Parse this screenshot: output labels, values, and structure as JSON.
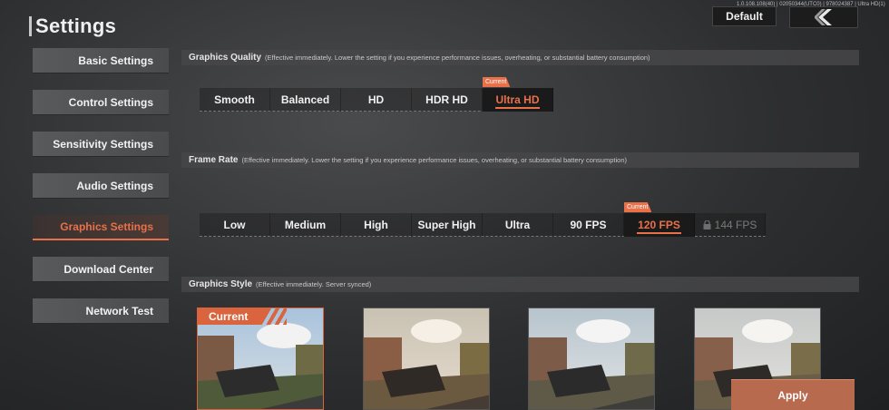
{
  "header": {
    "title": "Settings",
    "build_info": "1.0.108.108(40) | 02050344(UTC0) | 978024387 | Ultra HD(1)",
    "default_label": "Default",
    "back_icon": "chevron-left-icon"
  },
  "sidebar": {
    "items": [
      {
        "label": "Basic Settings",
        "active": false
      },
      {
        "label": "Control Settings",
        "active": false
      },
      {
        "label": "Sensitivity Settings",
        "active": false
      },
      {
        "label": "Audio Settings",
        "active": false
      },
      {
        "label": "Graphics Settings",
        "active": true
      },
      {
        "label": "Download Center",
        "active": false
      },
      {
        "label": "Network Test",
        "active": false
      }
    ]
  },
  "graphics_quality": {
    "title": "Graphics Quality",
    "note": "(Effective immediately. Lower the setting if you experience performance issues, overheating, or substantial battery consumption)",
    "options": [
      "Smooth",
      "Balanced",
      "HD",
      "HDR HD",
      "Ultra HD"
    ],
    "selected": "Ultra HD",
    "current_badge": "Current"
  },
  "frame_rate": {
    "title": "Frame Rate",
    "note": "(Effective immediately. Lower the setting if you experience performance issues, overheating, or substantial battery consumption)",
    "options": [
      "Low",
      "Medium",
      "High",
      "Super High",
      "Ultra",
      "90 FPS",
      "120 FPS",
      "144 FPS"
    ],
    "selected": "120 FPS",
    "locked": "144 FPS",
    "current_badge": "Current"
  },
  "graphics_style": {
    "title": "Graphics Style",
    "note": "(Effective immediately. Server synced)",
    "current_tag": "Current"
  },
  "apply_label": "Apply",
  "colors": {
    "accent": "#e8714a",
    "apply_bg": "#b86a4e"
  }
}
